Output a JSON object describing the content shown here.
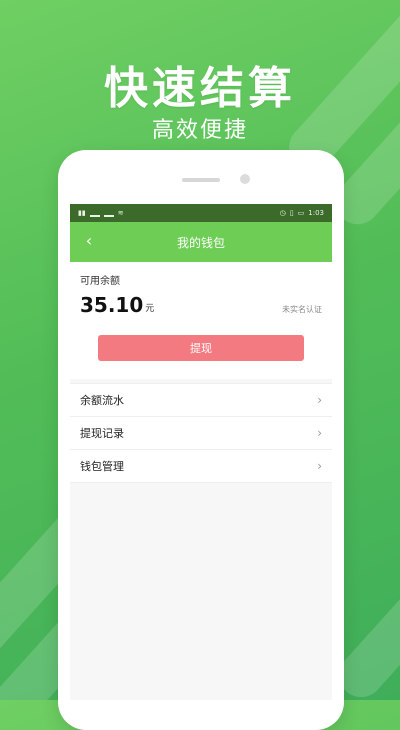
{
  "hero": {
    "title": "快速结算",
    "subtitle": "高效便捷"
  },
  "statusbar": {
    "time": "1:03"
  },
  "navbar": {
    "title": "我的钱包",
    "back_icon": "chevron-left-icon"
  },
  "balance": {
    "label": "可用余额",
    "amount": "35.10",
    "unit": "元",
    "realname_status": "未实名认证"
  },
  "actions": {
    "withdraw_label": "提现"
  },
  "menu": {
    "items": [
      {
        "label": "余额流水"
      },
      {
        "label": "提现记录"
      },
      {
        "label": "钱包管理"
      }
    ]
  },
  "colors": {
    "accent": "#6dcd55",
    "statusbar": "#3b6a2a",
    "withdraw": "#f27a80"
  }
}
